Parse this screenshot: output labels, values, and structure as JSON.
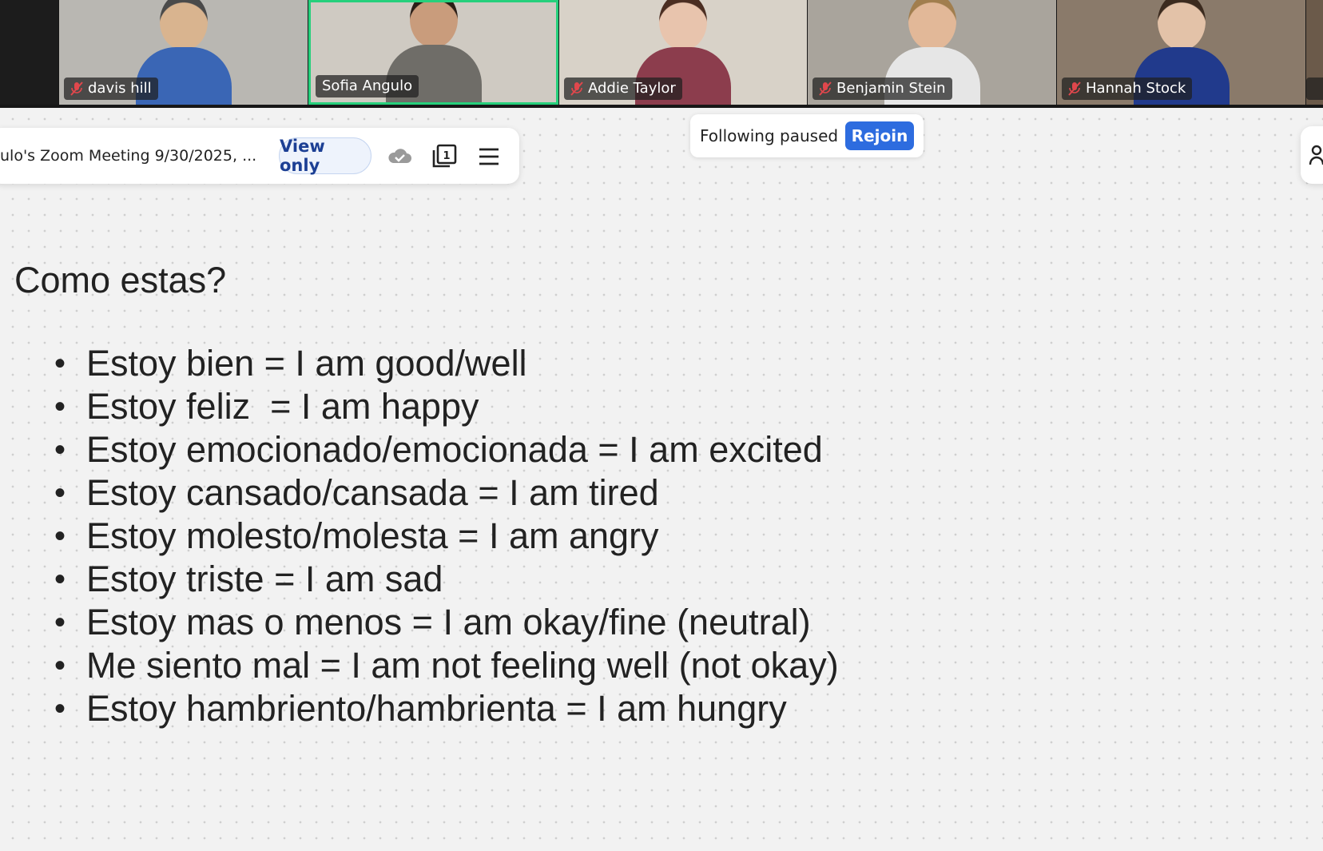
{
  "participants": [
    {
      "name": "davis hill",
      "muted": true,
      "active": false,
      "bg": "#b9b7b2",
      "skin": "#d9b48f",
      "shirt": "#3a66b5",
      "hair": "#4a4a4a"
    },
    {
      "name": "Sofia Angulo",
      "muted": false,
      "active": true,
      "bg": "#cfcac2",
      "skin": "#c99c7c",
      "shirt": "#6f6d68",
      "hair": "#2b1e16"
    },
    {
      "name": "Addie Taylor",
      "muted": true,
      "active": false,
      "bg": "#d8d2c8",
      "skin": "#e8c4ad",
      "shirt": "#8c3d4d",
      "hair": "#4b2e22"
    },
    {
      "name": "Benjamin Stein",
      "muted": true,
      "active": false,
      "bg": "#a9a49c",
      "skin": "#e2b898",
      "shirt": "#e6e6e6",
      "hair": "#a17e4e"
    },
    {
      "name": "Hannah Stock",
      "muted": true,
      "active": false,
      "bg": "#8a7a6a",
      "skin": "#e3c2a8",
      "shirt": "#213a8c",
      "hair": "#3b2a1e"
    }
  ],
  "toolbar": {
    "doc_title": "ulo's Zoom Meeting 9/30/2025, ...",
    "view_only_label": "View only",
    "icons": [
      "cloud-icon",
      "pages-icon",
      "menu-icon"
    ],
    "page_badge": "1"
  },
  "following": {
    "label": "Following paused",
    "rejoin_label": "Rejoin"
  },
  "board": {
    "heading": "Como estas?",
    "items": [
      "Estoy bien = I am good/well",
      "Estoy feliz  = I am happy",
      "Estoy emocionado/emocionada = I am excited",
      "Estoy cansado/cansada = I am tired",
      "Estoy molesto/molesta = I am angry",
      "Estoy triste = I am sad",
      "Estoy mas o menos = I am okay/fine (neutral)",
      "Me siento mal = I am not feeling well (not okay)",
      "Estoy hambriento/hambrienta = I am hungry"
    ]
  },
  "colors": {
    "accent": "#2d6cdf",
    "active_speaker": "#26d07c",
    "mute_red": "#e0474c"
  }
}
